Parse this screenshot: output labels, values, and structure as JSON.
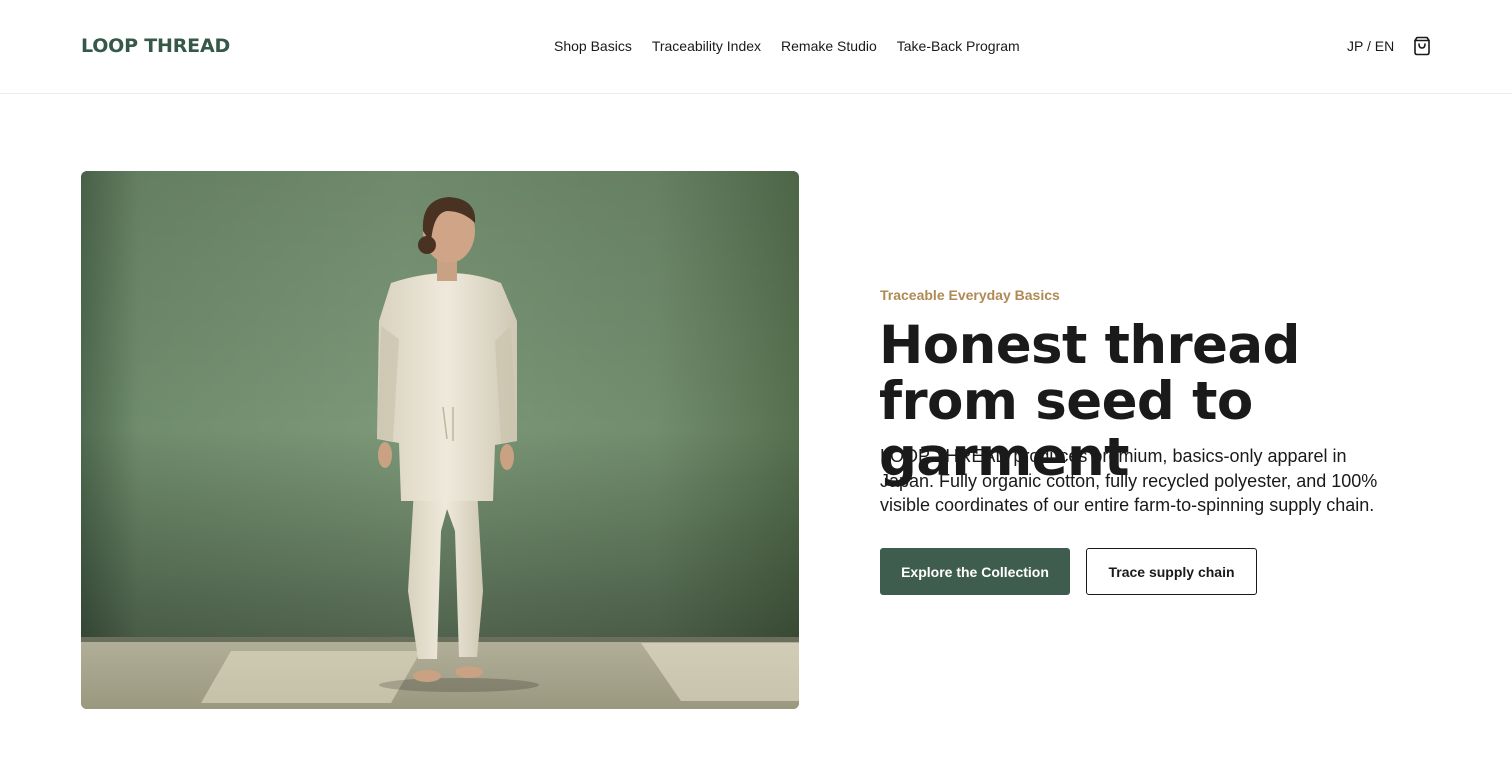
{
  "header": {
    "logo": "LOOP THREAD",
    "nav": [
      {
        "label": "Shop Basics"
      },
      {
        "label": "Traceability Index"
      },
      {
        "label": "Remake Studio"
      },
      {
        "label": "Take-Back Program"
      }
    ],
    "language": "JP / EN",
    "cart_icon": "shopping-bag-icon"
  },
  "hero": {
    "image": "model-in-cream-sweatshirt-and-joggers-photo",
    "eyebrow": "Traceable Everyday Basics",
    "headline": "Honest thread from seed to garment",
    "body": "LOOP THREAD produces premium, basics-only apparel in Japan. Fully organic cotton, fully recycled polyester, and 100% visible coordinates of our entire farm-to-spinning supply chain.",
    "primary_cta": "Explore the Collection",
    "secondary_cta": "Trace supply chain"
  },
  "colors": {
    "brand_green": "#355848",
    "button_green": "#3f5d4e",
    "eyebrow_gold": "#b08a55",
    "wall_green": "#6e8a6a"
  }
}
